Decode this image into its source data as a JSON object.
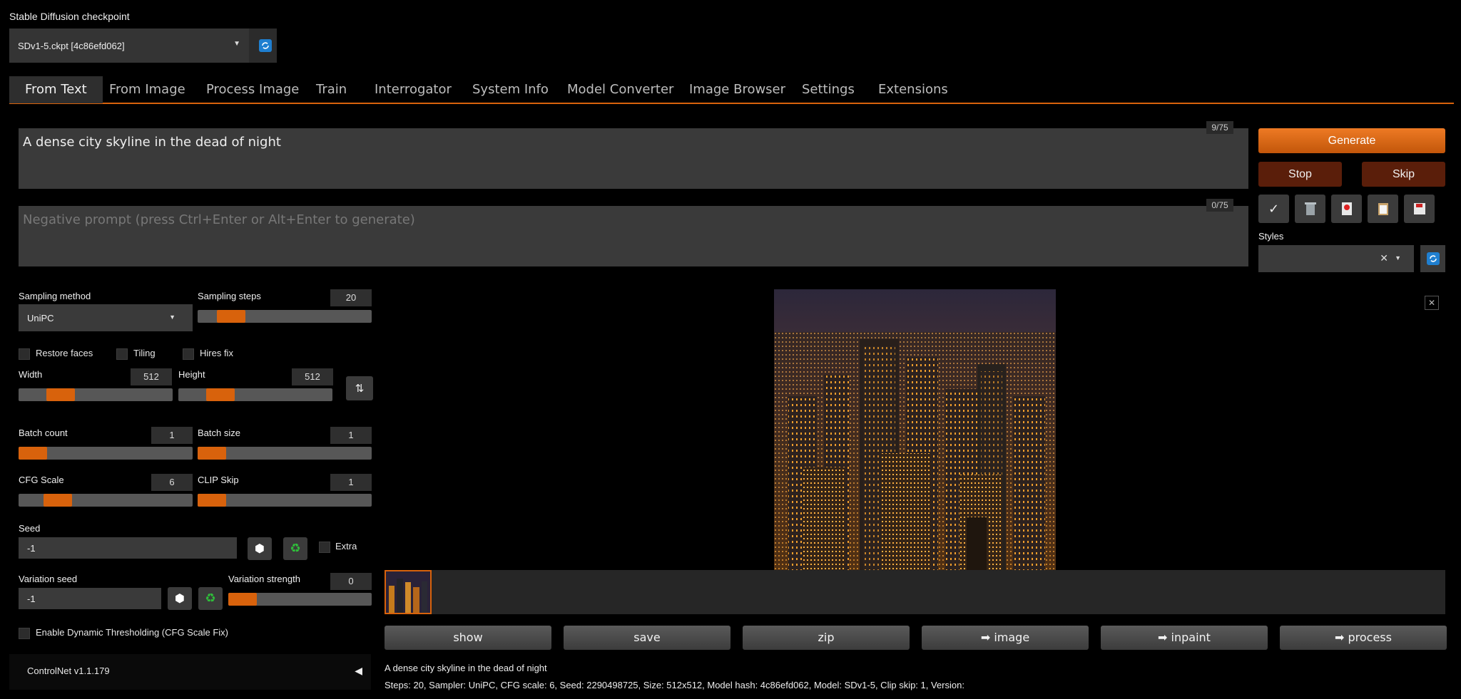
{
  "checkpoint": {
    "label": "Stable Diffusion checkpoint",
    "value": "SDv1-5.ckpt [4c86efd062]"
  },
  "tabs": [
    "From Text",
    "From Image",
    "Process Image",
    "Train",
    "Interrogator",
    "System Info",
    "Model Converter",
    "Image Browser",
    "Settings",
    "Extensions"
  ],
  "prompt": {
    "value": "A dense city skyline in the dead of night",
    "token_count": "9/75"
  },
  "negative_prompt": {
    "placeholder": "Negative prompt (press Ctrl+Enter or Alt+Enter to generate)",
    "token_count": "0/75"
  },
  "actions": {
    "generate": "Generate",
    "stop": "Stop",
    "skip": "Skip",
    "styles_label": "Styles"
  },
  "sampling": {
    "method_label": "Sampling method",
    "method_value": "UniPC",
    "steps_label": "Sampling steps",
    "steps_value": "20",
    "steps_fraction": 0.13
  },
  "toggles": {
    "restore_faces": "Restore faces",
    "tiling": "Tiling",
    "hires_fix": "Hires fix"
  },
  "size": {
    "width_label": "Width",
    "width_value": "512",
    "height_label": "Height",
    "height_value": "512"
  },
  "batch": {
    "count_label": "Batch count",
    "count_value": "1",
    "size_label": "Batch size",
    "size_value": "1"
  },
  "cfg": {
    "cfg_label": "CFG Scale",
    "cfg_value": "6",
    "clip_label": "CLIP Skip",
    "clip_value": "1"
  },
  "seed": {
    "label": "Seed",
    "value": "-1",
    "extra_label": "Extra"
  },
  "variation": {
    "seed_label": "Variation seed",
    "seed_value": "-1",
    "strength_label": "Variation strength",
    "strength_value": "0"
  },
  "dynamic_thresholding": "Enable Dynamic Thresholding (CFG Scale Fix)",
  "controlnet": "ControlNet v1.1.179",
  "output_buttons": [
    "show",
    "save",
    "zip",
    "➡ image",
    "➡ inpaint",
    "➡ process"
  ],
  "info": {
    "prompt": "A dense city skyline in the dead of night",
    "params": "Steps: 20, Sampler: UniPC, CFG scale: 6, Seed: 2290498725, Size: 512x512, Model hash: 4c86efd062, Model: SDv1-5, Clip skip: 1, Version:"
  },
  "colors": {
    "accent": "#d8620c",
    "stop_bg": "#5a1e0a",
    "blue_refresh": "#1f7fd0"
  }
}
